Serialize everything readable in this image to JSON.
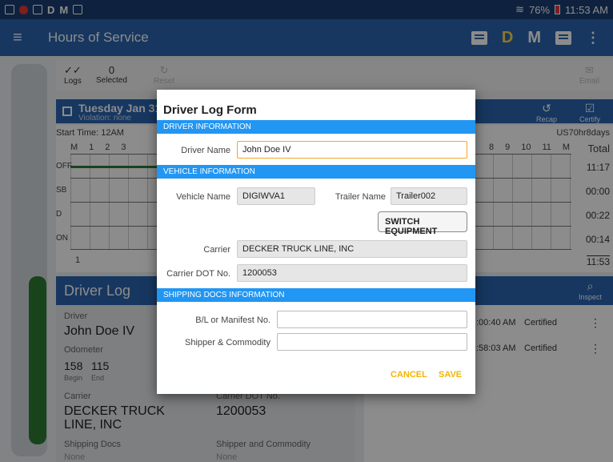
{
  "statusbar": {
    "left_letters": [
      "D",
      "M"
    ],
    "battery": "76%",
    "time": "11:53 AM"
  },
  "appbar": {
    "title": "Hours of Service",
    "d_label": "D",
    "m_label": "M"
  },
  "toolbar": {
    "logs_label": "Logs",
    "selected_count": "0",
    "selected_label": "Selected",
    "reset_label": "Reset",
    "email_label": "Email"
  },
  "day": {
    "date": "Tuesday Jan 31",
    "violation": "Violation: none",
    "recap": "Recap",
    "certify": "Certify",
    "start_time": "Start Time: 12AM",
    "ruleset": "US70hr8days",
    "hours_left": [
      "M",
      "1",
      "2",
      "3"
    ],
    "hours_right": [
      "8",
      "9",
      "10",
      "11",
      "M"
    ],
    "total_label": "Total",
    "rows": [
      "OFF",
      "SB",
      "D",
      "ON"
    ],
    "totals": [
      "11:17",
      "00:00",
      "00:22",
      "00:14"
    ],
    "grand_total": "11:53",
    "first_bottom": "1"
  },
  "driver_log": {
    "title": "Driver Log",
    "driver_label": "Driver",
    "driver_value": "John Doe IV",
    "odometer_label": "Odometer",
    "odo_begin": "158",
    "odo_end": "115",
    "begin_label": "Begin",
    "end_label": "End",
    "carrier_label": "Carrier",
    "carrier_value": "DECKER TRUCK LINE, INC",
    "carrier_dot_label": "Carrier DOT No.",
    "carrier_dot_value": "1200053",
    "shipping_label": "Shipping Docs",
    "shipping_value": "None",
    "shipper_label": "Shipper and Commodity",
    "shipper_value": "None"
  },
  "right_panel": {
    "inspect_label": "Inspect",
    "rows": [
      {
        "time": ":00:40 AM",
        "status": "Certified"
      },
      {
        "time": ":58:03 AM",
        "status": "Certified"
      }
    ]
  },
  "dialog": {
    "title": "Driver Log Form",
    "section_driver": "DRIVER INFORMATION",
    "driver_name_label": "Driver Name",
    "driver_name_value": "John Doe IV",
    "section_vehicle": "VEHICLE INFORMATION",
    "vehicle_name_label": "Vehicle Name",
    "vehicle_name_value": "DIGIWVA1",
    "trailer_name_label": "Trailer Name",
    "trailer_name_value": "Trailer002",
    "switch_button": "SWITCH EQUIPMENT",
    "carrier_label": "Carrier",
    "carrier_value": "DECKER TRUCK LINE, INC",
    "carrier_dot_label": "Carrier DOT No.",
    "carrier_dot_value": "1200053",
    "section_shipping": "SHIPPING DOCS INFORMATION",
    "bl_label": "B/L or Manifest No.",
    "bl_value": "",
    "shipper_label": "Shipper & Commodity",
    "shipper_value": "",
    "cancel": "CANCEL",
    "save": "SAVE"
  },
  "colors": {
    "appbar": "#2a64b0",
    "section": "#2196f3",
    "accent": "#f5b400"
  }
}
